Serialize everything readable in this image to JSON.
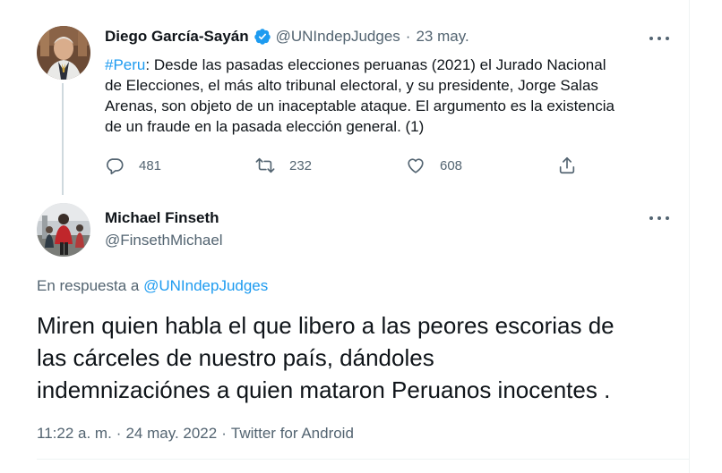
{
  "tweet1": {
    "author_name": "Diego García-Sayán",
    "handle": "@UNIndepJudges",
    "separator": "·",
    "date": "23 may.",
    "hashtag": "#Peru",
    "text_lines": [
      ": Desde las pasadas elecciones peruanas (2021) el Jurado Nacional",
      "de Elecciones, el más alto tribunal electoral, y su presidente, Jorge Salas",
      "Arenas, son  objeto de un inaceptable ataque. El argumento es la existencia",
      "de un fraude en la pasada elección general. (1)"
    ],
    "replies": "481",
    "retweets": "232",
    "likes": "608",
    "verified_color": "#1d9bf0"
  },
  "tweet2": {
    "author_name": "Michael Finseth",
    "handle": "@FinsethMichael",
    "reply_prefix": "En respuesta a",
    "reply_mention": "@UNIndepJudges",
    "text_lines": [
      "Miren quien habla el que libero a las peores escorias de",
      "las cárceles de nuestro país, dándoles",
      "indemnizaciónes a quien mataron Peruanos inocentes ."
    ],
    "time": "11:22 a. m.",
    "separator": "·",
    "date": "24 may. 2022",
    "source": "Twitter for Android"
  },
  "icons": {
    "more": "more-horizontal-icon",
    "reply": "reply-icon",
    "retweet": "retweet-icon",
    "like": "like-icon",
    "share": "share-icon",
    "verified": "verified-badge-icon"
  },
  "colors": {
    "accent": "#1d9bf0",
    "secondary_text": "#536471",
    "primary_text": "#0f1419"
  }
}
